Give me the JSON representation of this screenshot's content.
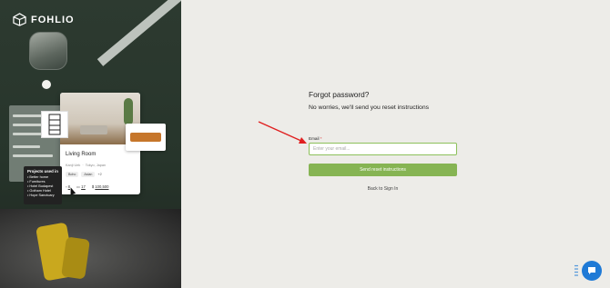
{
  "brand": {
    "name": "FOHLIO"
  },
  "hero": {
    "project_card": {
      "title": "Living Room",
      "location_left": "Kanji Uek",
      "location_right": "Tokyo, Japan",
      "tags": [
        "Boho",
        "Asian"
      ],
      "more_tags": "+2",
      "stats": {
        "items": "8",
        "projects": "17",
        "budget": "100,500"
      },
      "budget_symbol": "$"
    },
    "projects_tooltip": {
      "title": "Projects used in",
      "items": [
        "Better home",
        "Furnitures",
        "Hotel Budapest",
        "Gotham Hotel",
        "Hope Sanctuary"
      ]
    }
  },
  "form": {
    "title": "Forgot password?",
    "subtitle": "No worries, we'll send you reset instructions",
    "email_label": "Email",
    "required_mark": "*",
    "email_placeholder": "Enter your email...",
    "email_value": "",
    "submit_label": "Send reset instructions",
    "back_link": "Back to Sign In"
  },
  "colors": {
    "accent_green": "#86b453",
    "annotation_arrow": "#e02020",
    "chat_button": "#1f7ad6"
  },
  "icons": [
    "logo-cube-icon",
    "chat-bubble-icon",
    "drag-dots-icon",
    "pointer-cursor-icon",
    "calendar-icon",
    "dollar-icon"
  ]
}
